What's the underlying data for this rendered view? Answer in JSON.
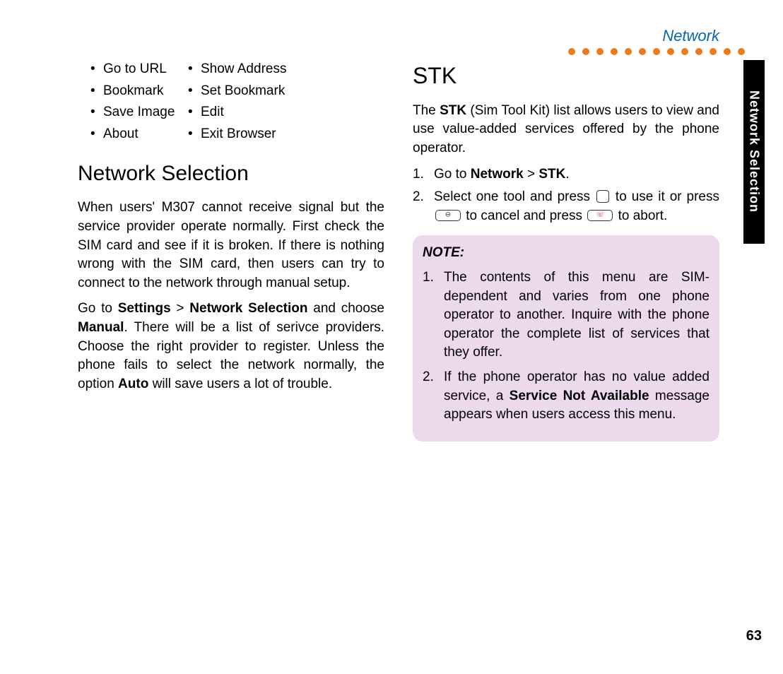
{
  "header": {
    "label": "Network"
  },
  "sideTab": "Network Selection",
  "pageNumber": "63",
  "leftCol": {
    "bullets": [
      [
        "Go to URL",
        "Show Address"
      ],
      [
        "Bookmark",
        "Set Bookmark"
      ],
      [
        "Save Image",
        "Edit"
      ],
      [
        "About",
        "Exit Browser"
      ]
    ],
    "heading": "Network Selection",
    "para1": "When users' M307 cannot receive signal but the service provider operate normally. First check the SIM card and see if it is broken. If there is nothing wrong with the SIM card, then users can try to connect to the network through manual setup.",
    "para2_pre": "Go to ",
    "para2_b1": "Settings",
    "para2_gt": " > ",
    "para2_b2": "Network Selection",
    "para2_mid": " and choose ",
    "para2_b3": "Manual",
    "para2_post1": ". There will be a list of serivce providers. Choose the right provider to register. Unless the phone fails to select the network normally, the option ",
    "para2_b4": "Auto",
    "para2_post2": " will save users a lot of trouble."
  },
  "rightCol": {
    "heading": "STK",
    "intro_pre": "The ",
    "intro_b": "STK",
    "intro_post": " (Sim Tool Kit) list allows users to view and use value-added services offered by the phone operator.",
    "step1_pre": "Go to ",
    "step1_b1": "Network",
    "step1_gt": " > ",
    "step1_b2": "STK",
    "step1_post": ".",
    "step2_a": "Select one tool and press ",
    "step2_b": " to use it or press ",
    "step2_c": " to cancel and press ",
    "step2_d": " to abort.",
    "note": {
      "title": "NOTE:",
      "item1": "The contents of this menu are SIM-dependent and varies from one phone operator to another. Inquire with the phone operator the complete list of services that they offer.",
      "item2_pre": "If the phone operator has no value added service, a ",
      "item2_b": "Service Not Available",
      "item2_post": " message appears when users access this menu."
    }
  }
}
